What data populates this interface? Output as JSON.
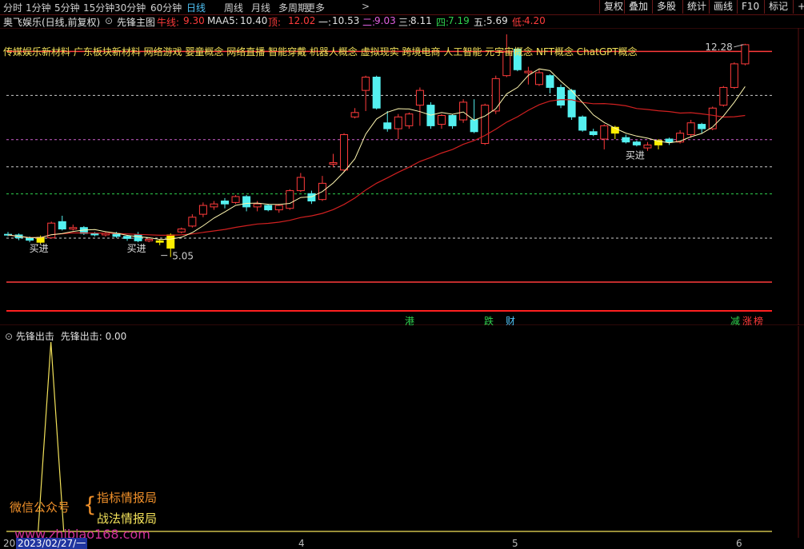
{
  "toolbar": {
    "periods": [
      "分时",
      "1分钟",
      "5分钟",
      "15分钟",
      "30分钟",
      "60分钟",
      "日线",
      "周线",
      "月线",
      "多周期",
      "更多"
    ],
    "more_arrow": ">",
    "right_buttons": [
      "复权",
      "叠加",
      "多股",
      "统计",
      "画线",
      "F10",
      "标记"
    ],
    "right_tail": "+",
    "active_period": "日线"
  },
  "info": {
    "stock": "奥飞娱乐(日线,前复权)",
    "indicator": "先锋主图",
    "niu_label": "牛线:",
    "niu_val": "9.30",
    "maa5_label": "MAA5:",
    "maa5_val": "10.40",
    "ding_label": "顶:",
    "ding_val": "12.02",
    "yi_label": "一:",
    "yi_val": "10.53",
    "er_label": "二:",
    "er_val": "9.03",
    "san_label": "三:",
    "san_val": "8.11",
    "si_label": "四:",
    "si_val": "7.19",
    "wu_label": "五:",
    "wu_val": "5.69",
    "di_label": "低:",
    "di_val": "4.20"
  },
  "concepts": "传媒娱乐新材料 广东板块新材料 网络游戏 婴童概念 网络直播 智能穿戴 机器人概念 虚拟现实 跨境电商 人工智能 元宇宙概念 NFT概念 ChatGPT概念",
  "annotations": {
    "high_label": "12.28",
    "low_label": "5.05",
    "buy": "买进",
    "tags": [
      {
        "text": "港",
        "color": "#2fd24f"
      },
      {
        "text": "跌",
        "color": "#2fd24f"
      },
      {
        "text": "财",
        "color": "#4fc3f7"
      },
      {
        "text": "减",
        "color": "#2fd24f"
      },
      {
        "text": "涨",
        "color": "#ff3b3b"
      },
      {
        "text": "榜",
        "color": "#ff3b3b"
      }
    ]
  },
  "lower": {
    "name": "先锋出击",
    "value_label": "先锋出击: 0.00"
  },
  "watermark": {
    "wechat": "微信公众号",
    "line1": "指标情报局",
    "line2": "战法情报局",
    "url": "www.zhibiao168.com"
  },
  "xaxis": {
    "date_box": "2023/02/27/一",
    "date_prefix": "20",
    "months": [
      "4",
      "5",
      "6"
    ]
  },
  "colors": {
    "up": "#ff3b3b",
    "down": "#54f0f0",
    "buy_bar": "#ffee00",
    "ma_short": "#fff7b0",
    "ma_long": "#d02020"
  },
  "chart_data": {
    "type": "candlestick",
    "ylim": [
      4.2,
      12.6
    ],
    "candles": [
      {
        "o": 5.82,
        "c": 5.8,
        "h": 5.9,
        "l": 5.75
      },
      {
        "o": 5.8,
        "c": 5.7,
        "h": 5.85,
        "l": 5.62
      },
      {
        "o": 5.68,
        "c": 5.62,
        "h": 5.75,
        "l": 5.55
      },
      {
        "o": 5.55,
        "c": 5.72,
        "h": 5.78,
        "l": 5.5
      },
      {
        "o": 5.7,
        "c": 6.2,
        "h": 6.25,
        "l": 5.68
      },
      {
        "o": 6.25,
        "c": 6.0,
        "h": 6.45,
        "l": 5.95
      },
      {
        "o": 6.0,
        "c": 6.05,
        "h": 6.15,
        "l": 5.95
      },
      {
        "o": 6.05,
        "c": 5.85,
        "h": 6.1,
        "l": 5.8
      },
      {
        "o": 5.85,
        "c": 5.8,
        "h": 5.9,
        "l": 5.75
      },
      {
        "o": 5.8,
        "c": 5.85,
        "h": 5.9,
        "l": 5.75
      },
      {
        "o": 5.85,
        "c": 5.75,
        "h": 5.9,
        "l": 5.7
      },
      {
        "o": 5.75,
        "c": 5.68,
        "h": 5.8,
        "l": 5.6
      },
      {
        "o": 5.8,
        "c": 5.6,
        "h": 5.9,
        "l": 5.55
      },
      {
        "o": 5.6,
        "c": 5.65,
        "h": 5.7,
        "l": 5.55
      },
      {
        "o": 5.6,
        "c": 5.55,
        "h": 5.65,
        "l": 5.45
      },
      {
        "o": 5.35,
        "c": 5.8,
        "h": 5.85,
        "l": 5.05
      },
      {
        "o": 5.9,
        "c": 6.0,
        "h": 6.05,
        "l": 5.85
      },
      {
        "o": 6.1,
        "c": 6.4,
        "h": 6.5,
        "l": 6.05
      },
      {
        "o": 6.5,
        "c": 6.8,
        "h": 6.9,
        "l": 6.4
      },
      {
        "o": 6.75,
        "c": 6.85,
        "h": 6.95,
        "l": 6.65
      },
      {
        "o": 6.95,
        "c": 6.85,
        "h": 7.05,
        "l": 6.7
      },
      {
        "o": 6.9,
        "c": 7.1,
        "h": 7.15,
        "l": 6.85
      },
      {
        "o": 7.1,
        "c": 6.75,
        "h": 7.15,
        "l": 6.6
      },
      {
        "o": 6.75,
        "c": 6.85,
        "h": 6.95,
        "l": 6.6
      },
      {
        "o": 6.8,
        "c": 6.65,
        "h": 6.85,
        "l": 6.6
      },
      {
        "o": 6.65,
        "c": 6.8,
        "h": 6.85,
        "l": 6.55
      },
      {
        "o": 6.7,
        "c": 7.3,
        "h": 7.35,
        "l": 6.65
      },
      {
        "o": 7.3,
        "c": 7.75,
        "h": 7.9,
        "l": 7.25
      },
      {
        "o": 7.2,
        "c": 6.95,
        "h": 7.3,
        "l": 6.85
      },
      {
        "o": 7.0,
        "c": 7.55,
        "h": 7.8,
        "l": 6.95
      },
      {
        "o": 8.2,
        "c": 8.25,
        "h": 8.55,
        "l": 8.1
      },
      {
        "o": 8.0,
        "c": 9.2,
        "h": 9.25,
        "l": 7.95
      },
      {
        "o": 9.8,
        "c": 9.95,
        "h": 10.1,
        "l": 9.75
      },
      {
        "o": 10.7,
        "c": 11.15,
        "h": 11.2,
        "l": 10.0
      },
      {
        "o": 11.15,
        "c": 10.1,
        "h": 11.2,
        "l": 10.05
      },
      {
        "o": 9.6,
        "c": 9.4,
        "h": 10.0,
        "l": 9.3
      },
      {
        "o": 9.4,
        "c": 9.8,
        "h": 9.9,
        "l": 9.05
      },
      {
        "o": 9.5,
        "c": 9.9,
        "h": 9.95,
        "l": 9.4
      },
      {
        "o": 10.2,
        "c": 10.7,
        "h": 10.8,
        "l": 9.5
      },
      {
        "o": 10.2,
        "c": 9.5,
        "h": 10.3,
        "l": 9.4
      },
      {
        "o": 9.55,
        "c": 9.85,
        "h": 9.9,
        "l": 9.4
      },
      {
        "o": 9.85,
        "c": 9.5,
        "h": 9.9,
        "l": 9.4
      },
      {
        "o": 9.7,
        "c": 10.3,
        "h": 10.4,
        "l": 9.6
      },
      {
        "o": 9.7,
        "c": 9.3,
        "h": 10.4,
        "l": 9.25
      },
      {
        "o": 8.9,
        "c": 10.2,
        "h": 10.25,
        "l": 8.85
      },
      {
        "o": 10.0,
        "c": 11.1,
        "h": 11.2,
        "l": 9.9
      },
      {
        "o": 11.2,
        "c": 12.0,
        "h": 12.6,
        "l": 11.15
      },
      {
        "o": 12.1,
        "c": 11.4,
        "h": 12.15,
        "l": 11.35
      },
      {
        "o": 11.3,
        "c": 11.35,
        "h": 11.5,
        "l": 10.9
      },
      {
        "o": 10.9,
        "c": 11.3,
        "h": 11.4,
        "l": 10.85
      },
      {
        "o": 11.2,
        "c": 10.8,
        "h": 11.25,
        "l": 10.6
      },
      {
        "o": 10.8,
        "c": 10.2,
        "h": 10.9,
        "l": 10.1
      },
      {
        "o": 10.7,
        "c": 9.8,
        "h": 10.75,
        "l": 9.7
      },
      {
        "o": 9.8,
        "c": 9.35,
        "h": 9.85,
        "l": 9.3
      },
      {
        "o": 9.3,
        "c": 9.2,
        "h": 9.4,
        "l": 9.15
      },
      {
        "o": 9.05,
        "c": 9.5,
        "h": 9.55,
        "l": 8.7
      },
      {
        "o": 9.45,
        "c": 9.25,
        "h": 9.5,
        "l": 9.05
      },
      {
        "o": 9.1,
        "c": 8.95,
        "h": 9.2,
        "l": 8.9
      },
      {
        "o": 8.95,
        "c": 8.85,
        "h": 9.0,
        "l": 8.8
      },
      {
        "o": 8.75,
        "c": 8.85,
        "h": 8.95,
        "l": 8.65
      },
      {
        "o": 8.85,
        "c": 9.0,
        "h": 9.05,
        "l": 8.7
      },
      {
        "o": 9.05,
        "c": 8.95,
        "h": 9.1,
        "l": 8.85
      },
      {
        "o": 8.95,
        "c": 9.25,
        "h": 9.35,
        "l": 8.9
      },
      {
        "o": 9.2,
        "c": 9.6,
        "h": 9.7,
        "l": 9.1
      },
      {
        "o": 9.55,
        "c": 9.4,
        "h": 9.6,
        "l": 9.25
      },
      {
        "o": 9.4,
        "c": 10.1,
        "h": 10.15,
        "l": 9.35
      },
      {
        "o": 10.2,
        "c": 10.8,
        "h": 10.85,
        "l": 10.15
      },
      {
        "o": 10.8,
        "c": 11.6,
        "h": 11.65,
        "l": 10.75
      },
      {
        "o": 11.6,
        "c": 12.25,
        "h": 12.28,
        "l": 11.55
      }
    ],
    "buy_indices": [
      3,
      14,
      15,
      56,
      60
    ],
    "guide_levels": [
      12.02,
      10.53,
      9.03,
      8.11,
      7.19,
      5.69,
      4.2
    ],
    "lower_series": {
      "name": "先锋出击",
      "spike_index": 3,
      "spike_value": 1.0,
      "ylim": [
        0,
        1
      ]
    }
  }
}
